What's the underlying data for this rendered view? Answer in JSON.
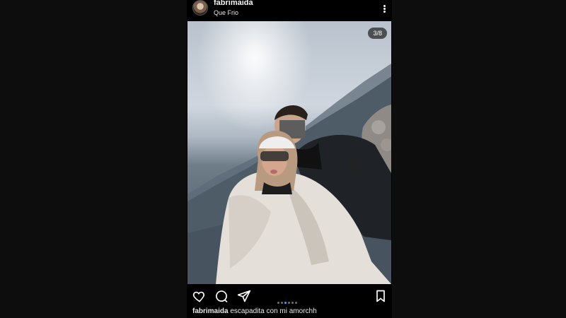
{
  "post": {
    "username": "fabrimaida",
    "location": "Que Frio",
    "image_counter": "3/8",
    "caption_user": "fabrimaida",
    "caption_text": "escapadita con mi amorchh",
    "carousel": {
      "total": 8,
      "current": 3
    },
    "icons": {
      "avatar": "profile-avatar",
      "menu": "more-options-icon",
      "like": "heart-icon",
      "comment": "comment-icon",
      "share": "send-icon",
      "save": "bookmark-icon"
    },
    "colors": {
      "background": "#0d0d0d",
      "post_bg": "#000000",
      "active_dot": "#4aa3ff"
    }
  }
}
